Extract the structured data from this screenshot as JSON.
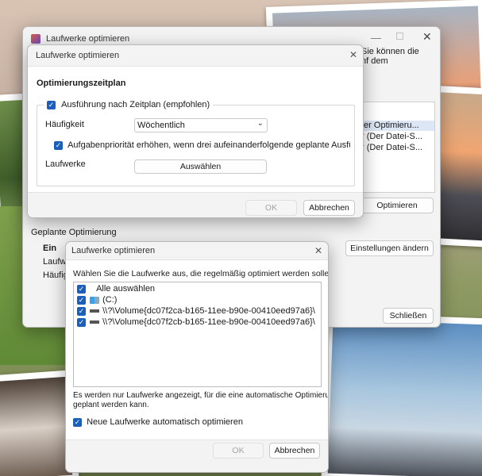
{
  "main_window": {
    "title": "Laufwerke optimieren",
    "behind_text_line1": "Sie können die",
    "behind_text_line2": "nf dem",
    "list_rows": [
      "ter Optimieru...",
      "r (Der Datei-S...",
      "r (Der Datei-S..."
    ],
    "optimize_button": "Optimieren",
    "scheduled_section_label": "Geplante Optimierung",
    "scheduled_status": "Ein",
    "scheduled_drives_label": "Laufwe",
    "scheduled_frequency_label": "Häufigk",
    "change_settings_button": "Einstellungen ändern",
    "close_button": "Schließen"
  },
  "schedule_dialog": {
    "title": "Laufwerke optimieren",
    "heading": "Optimierungszeitplan",
    "run_on_schedule_label": "Ausführung nach Zeitplan (empfohlen)",
    "frequency_label": "Häufigkeit",
    "frequency_value": "Wöchentlich",
    "priority_label": "Aufgabenpriorität erhöhen, wenn drei aufeinanderfolgende geplante Ausführungen verpa",
    "drives_label": "Laufwerke",
    "choose_button": "Auswählen",
    "ok_button": "OK",
    "cancel_button": "Abbrechen"
  },
  "drive_dialog": {
    "title": "Laufwerke optimieren",
    "instruction": "Wählen Sie die Laufwerke aus, die regelmäßig optimiert werden sollen:",
    "select_all": "Alle auswählen",
    "drives": [
      "(C:)",
      "\\\\?\\Volume{dc07f2ca-b165-11ee-b90e-00410eed97a6}\\",
      "\\\\?\\Volume{dc07f2cb-b165-11ee-b90e-00410eed97a6}\\"
    ],
    "note_line1": "Es werden nur Laufwerke angezeigt, für die eine automatische Optimierung",
    "note_line2": "geplant werden kann.",
    "auto_optimize_label": "Neue Laufwerke automatisch optimieren",
    "ok_button": "OK",
    "cancel_button": "Abbrechen"
  },
  "colors": {
    "accent": "#1b5fb8"
  }
}
